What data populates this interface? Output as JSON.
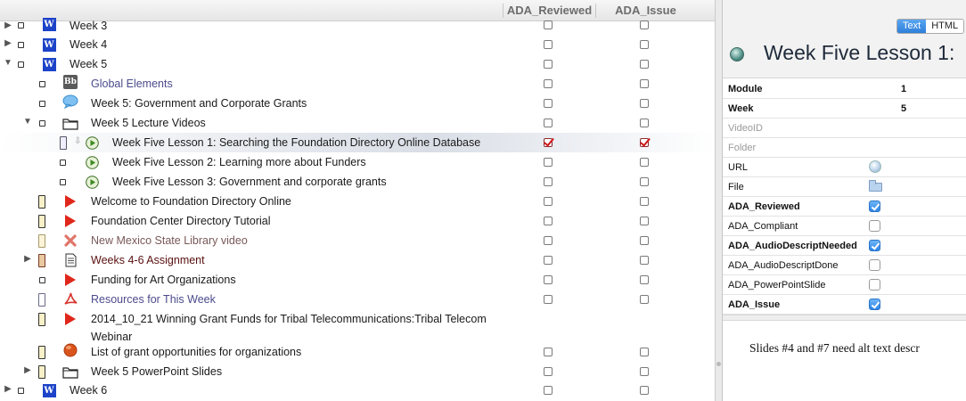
{
  "columns": {
    "reviewed": "ADA_Reviewed",
    "issue": "ADA_Issue"
  },
  "tree": [
    {
      "label": "Week 3",
      "toggle": "▶",
      "icon": "W",
      "reviewed": false,
      "issue": false
    },
    {
      "label": "Week 4",
      "toggle": "▶",
      "icon": "W",
      "reviewed": false,
      "issue": false
    },
    {
      "label": "Week 5",
      "toggle": "▼",
      "icon": "W",
      "reviewed": false,
      "issue": false
    },
    {
      "label": "Global Elements",
      "icon": "Bb",
      "reviewed": false,
      "issue": false
    },
    {
      "label": "Week 5: Government and Corporate Grants",
      "reviewed": false,
      "issue": false
    },
    {
      "label": "Week 5 Lecture Videos",
      "toggle": "▼",
      "reviewed": false,
      "issue": false
    },
    {
      "label": "Week Five Lesson 1: Searching the Foundation Directory Online Database",
      "reviewed": true,
      "issue": true
    },
    {
      "label": "Week Five Lesson 2: Learning more about Funders",
      "reviewed": false,
      "issue": false
    },
    {
      "label": "Week Five Lesson 3: Government and corporate grants",
      "reviewed": false,
      "issue": false
    },
    {
      "label": "Welcome to Foundation Directory Online",
      "reviewed": false,
      "issue": false
    },
    {
      "label": "Foundation Center Directory Tutorial",
      "reviewed": false,
      "issue": false
    },
    {
      "label": "New Mexico State Library video",
      "reviewed": false,
      "issue": false
    },
    {
      "label": "Weeks 4-6 Assignment",
      "toggle": "▶",
      "reviewed": false,
      "issue": false
    },
    {
      "label": "Funding for Art Organizations",
      "reviewed": false,
      "issue": false
    },
    {
      "label": "Resources for This Week",
      "reviewed": false,
      "issue": false
    },
    {
      "label": "2014_10_21 Winning Grant Funds for Tribal Telecommunications:Tribal Telecom",
      "label2": "Webinar",
      "reviewed": false,
      "issue": false
    },
    {
      "label": "List of grant opportunities for organizations",
      "reviewed": false,
      "issue": false
    },
    {
      "label": "Week 5 PowerPoint Slides",
      "toggle": "▶",
      "reviewed": false,
      "issue": false
    },
    {
      "label": "Week 6",
      "toggle": "▶",
      "icon": "W",
      "reviewed": false,
      "issue": false
    }
  ],
  "inspector": {
    "seg_text": "Text",
    "seg_html": "HTML",
    "title": "Week Five Lesson 1:",
    "props": [
      {
        "label": "Module",
        "value": "1"
      },
      {
        "label": "Week",
        "value": "5"
      },
      {
        "label": "VideoID"
      },
      {
        "label": "Folder"
      },
      {
        "label": "URL"
      },
      {
        "label": "File"
      },
      {
        "label": "ADA_Reviewed",
        "checked": true
      },
      {
        "label": "ADA_Compliant",
        "checked": false
      },
      {
        "label": "ADA_AudioDescriptNeeded",
        "checked": true
      },
      {
        "label": "ADA_AudioDescriptDone",
        "checked": false
      },
      {
        "label": "ADA_PowerPointSlide",
        "checked": false
      },
      {
        "label": "ADA_Issue",
        "checked": true
      }
    ],
    "notes": "Slides #4 and #7 need alt text descr"
  },
  "colors": {
    "accent": "#2e7fdb",
    "issue_check": "#d0171a",
    "week_icon": "#1c43c8",
    "link_text": "#4b4b8c",
    "assignment_text": "#5a1010"
  }
}
